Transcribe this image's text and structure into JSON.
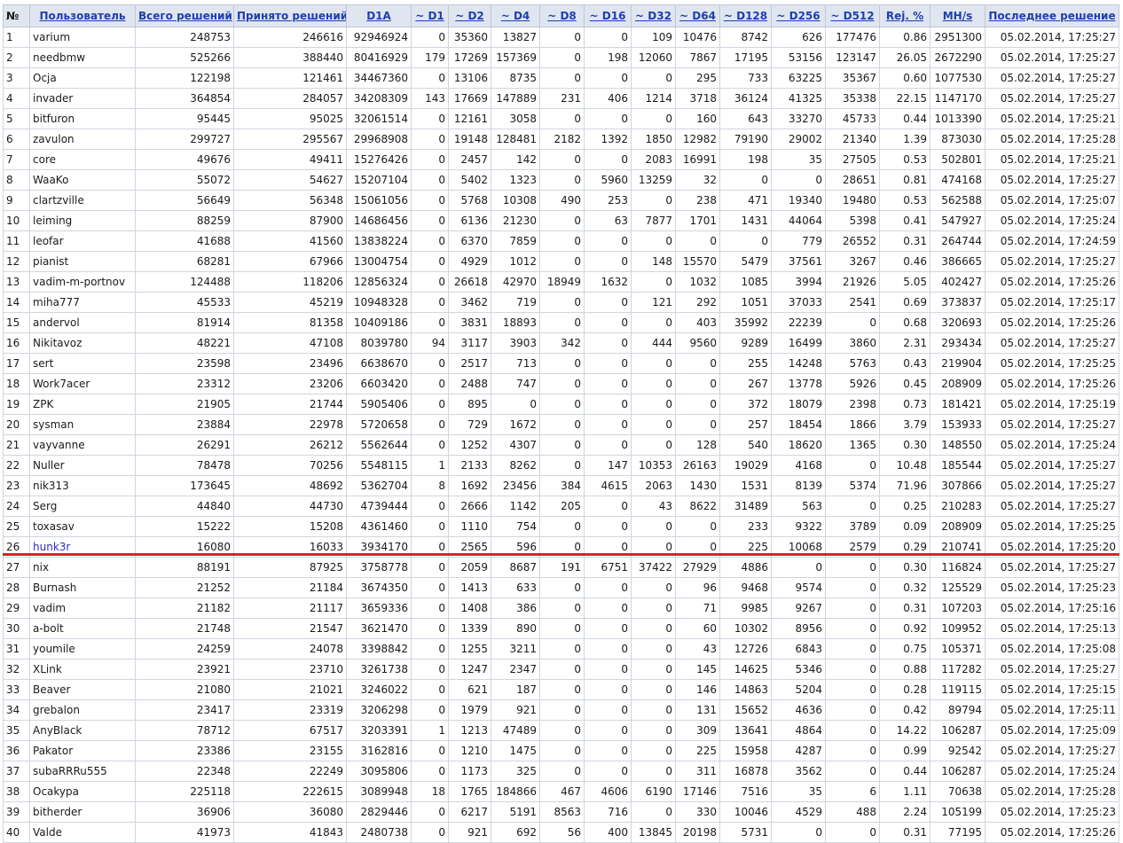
{
  "table": {
    "headers": [
      {
        "label": "№",
        "key": "num",
        "link": false
      },
      {
        "label": "Пользователь",
        "key": "user",
        "link": true
      },
      {
        "label": "Всего решений",
        "key": "total",
        "link": true
      },
      {
        "label": "Принято решений",
        "key": "accepted",
        "link": true
      },
      {
        "label": "D1A",
        "key": "d1a",
        "link": true
      },
      {
        "label": "~ D1",
        "key": "d1",
        "link": true
      },
      {
        "label": "~ D2",
        "key": "d2",
        "link": true
      },
      {
        "label": "~ D4",
        "key": "d4",
        "link": true
      },
      {
        "label": "~ D8",
        "key": "d8",
        "link": true
      },
      {
        "label": "~ D16",
        "key": "d16",
        "link": true
      },
      {
        "label": "~ D32",
        "key": "d32",
        "link": true
      },
      {
        "label": "~ D64",
        "key": "d64",
        "link": true
      },
      {
        "label": "~ D128",
        "key": "d128",
        "link": true
      },
      {
        "label": "~ D256",
        "key": "d256",
        "link": true
      },
      {
        "label": "~ D512",
        "key": "d512",
        "link": true
      },
      {
        "label": "Rej. %",
        "key": "rej",
        "link": true
      },
      {
        "label": "MH/s",
        "key": "mhs",
        "link": true
      },
      {
        "label": "Последнее решение",
        "key": "last",
        "link": true
      }
    ],
    "highlighted_row": 26,
    "highlight_color": "#e0202a",
    "rows": [
      [
        "1",
        "varium",
        "248753",
        "246616",
        "92946924",
        "0",
        "35360",
        "13827",
        "0",
        "0",
        "109",
        "10476",
        "8742",
        "626",
        "177476",
        "0.86",
        "2951300",
        "05.02.2014, 17:25:27"
      ],
      [
        "2",
        "needbmw",
        "525266",
        "388440",
        "80416929",
        "179",
        "17269",
        "157369",
        "0",
        "198",
        "12060",
        "7867",
        "17195",
        "53156",
        "123147",
        "26.05",
        "2672290",
        "05.02.2014, 17:25:27"
      ],
      [
        "3",
        "Ocja",
        "122198",
        "121461",
        "34467360",
        "0",
        "13106",
        "8735",
        "0",
        "0",
        "0",
        "295",
        "733",
        "63225",
        "35367",
        "0.60",
        "1077530",
        "05.02.2014, 17:25:27"
      ],
      [
        "4",
        "invader",
        "364854",
        "284057",
        "34208309",
        "143",
        "17669",
        "147889",
        "231",
        "406",
        "1214",
        "3718",
        "36124",
        "41325",
        "35338",
        "22.15",
        "1147170",
        "05.02.2014, 17:25:27"
      ],
      [
        "5",
        "bitfuron",
        "95445",
        "95025",
        "32061514",
        "0",
        "12161",
        "3058",
        "0",
        "0",
        "0",
        "160",
        "643",
        "33270",
        "45733",
        "0.44",
        "1013390",
        "05.02.2014, 17:25:21"
      ],
      [
        "6",
        "zavulon",
        "299727",
        "295567",
        "29968908",
        "0",
        "19148",
        "128481",
        "2182",
        "1392",
        "1850",
        "12982",
        "79190",
        "29002",
        "21340",
        "1.39",
        "873030",
        "05.02.2014, 17:25:28"
      ],
      [
        "7",
        "core",
        "49676",
        "49411",
        "15276426",
        "0",
        "2457",
        "142",
        "0",
        "0",
        "2083",
        "16991",
        "198",
        "35",
        "27505",
        "0.53",
        "502801",
        "05.02.2014, 17:25:21"
      ],
      [
        "8",
        "WaaKo",
        "55072",
        "54627",
        "15207104",
        "0",
        "5402",
        "1323",
        "0",
        "5960",
        "13259",
        "32",
        "0",
        "0",
        "28651",
        "0.81",
        "474168",
        "05.02.2014, 17:25:27"
      ],
      [
        "9",
        "clartzville",
        "56649",
        "56348",
        "15061056",
        "0",
        "5768",
        "10308",
        "490",
        "253",
        "0",
        "238",
        "471",
        "19340",
        "19480",
        "0.53",
        "562588",
        "05.02.2014, 17:25:07"
      ],
      [
        "10",
        "leiming",
        "88259",
        "87900",
        "14686456",
        "0",
        "6136",
        "21230",
        "0",
        "63",
        "7877",
        "1701",
        "1431",
        "44064",
        "5398",
        "0.41",
        "547927",
        "05.02.2014, 17:25:24"
      ],
      [
        "11",
        "leofar",
        "41688",
        "41560",
        "13838224",
        "0",
        "6370",
        "7859",
        "0",
        "0",
        "0",
        "0",
        "0",
        "779",
        "26552",
        "0.31",
        "264744",
        "05.02.2014, 17:24:59"
      ],
      [
        "12",
        "pianist",
        "68281",
        "67966",
        "13004754",
        "0",
        "4929",
        "1012",
        "0",
        "0",
        "148",
        "15570",
        "5479",
        "37561",
        "3267",
        "0.46",
        "386665",
        "05.02.2014, 17:25:27"
      ],
      [
        "13",
        "vadim-m-portnov",
        "124488",
        "118206",
        "12856324",
        "0",
        "26618",
        "42970",
        "18949",
        "1632",
        "0",
        "1032",
        "1085",
        "3994",
        "21926",
        "5.05",
        "402427",
        "05.02.2014, 17:25:26"
      ],
      [
        "14",
        "miha777",
        "45533",
        "45219",
        "10948328",
        "0",
        "3462",
        "719",
        "0",
        "0",
        "121",
        "292",
        "1051",
        "37033",
        "2541",
        "0.69",
        "373837",
        "05.02.2014, 17:25:17"
      ],
      [
        "15",
        "andervol",
        "81914",
        "81358",
        "10409186",
        "0",
        "3831",
        "18893",
        "0",
        "0",
        "0",
        "403",
        "35992",
        "22239",
        "0",
        "0.68",
        "320693",
        "05.02.2014, 17:25:26"
      ],
      [
        "16",
        "Nikitavoz",
        "48221",
        "47108",
        "8039780",
        "94",
        "3117",
        "3903",
        "342",
        "0",
        "444",
        "9560",
        "9289",
        "16499",
        "3860",
        "2.31",
        "293434",
        "05.02.2014, 17:25:27"
      ],
      [
        "17",
        "sert",
        "23598",
        "23496",
        "6638670",
        "0",
        "2517",
        "713",
        "0",
        "0",
        "0",
        "0",
        "255",
        "14248",
        "5763",
        "0.43",
        "219904",
        "05.02.2014, 17:25:25"
      ],
      [
        "18",
        "Work7acer",
        "23312",
        "23206",
        "6603420",
        "0",
        "2488",
        "747",
        "0",
        "0",
        "0",
        "0",
        "267",
        "13778",
        "5926",
        "0.45",
        "208909",
        "05.02.2014, 17:25:26"
      ],
      [
        "19",
        "ZPK",
        "21905",
        "21744",
        "5905406",
        "0",
        "895",
        "0",
        "0",
        "0",
        "0",
        "0",
        "372",
        "18079",
        "2398",
        "0.73",
        "181421",
        "05.02.2014, 17:25:19"
      ],
      [
        "20",
        "sysman",
        "23884",
        "22978",
        "5720658",
        "0",
        "729",
        "1672",
        "0",
        "0",
        "0",
        "0",
        "257",
        "18454",
        "1866",
        "3.79",
        "153933",
        "05.02.2014, 17:25:27"
      ],
      [
        "21",
        "vayvanne",
        "26291",
        "26212",
        "5562644",
        "0",
        "1252",
        "4307",
        "0",
        "0",
        "0",
        "128",
        "540",
        "18620",
        "1365",
        "0.30",
        "148550",
        "05.02.2014, 17:25:24"
      ],
      [
        "22",
        "Nuller",
        "78478",
        "70256",
        "5548115",
        "1",
        "2133",
        "8262",
        "0",
        "147",
        "10353",
        "26163",
        "19029",
        "4168",
        "0",
        "10.48",
        "185544",
        "05.02.2014, 17:25:27"
      ],
      [
        "23",
        "nik313",
        "173645",
        "48692",
        "5362704",
        "8",
        "1692",
        "23456",
        "384",
        "4615",
        "2063",
        "1430",
        "1531",
        "8139",
        "5374",
        "71.96",
        "307866",
        "05.02.2014, 17:25:27"
      ],
      [
        "24",
        "Serg",
        "44840",
        "44730",
        "4739444",
        "0",
        "2666",
        "1142",
        "205",
        "0",
        "43",
        "8622",
        "31489",
        "563",
        "0",
        "0.25",
        "210283",
        "05.02.2014, 17:25:27"
      ],
      [
        "25",
        "toxasav",
        "15222",
        "15208",
        "4361460",
        "0",
        "1110",
        "754",
        "0",
        "0",
        "0",
        "0",
        "233",
        "9322",
        "3789",
        "0.09",
        "208909",
        "05.02.2014, 17:25:25"
      ],
      [
        "26",
        "hunk3r",
        "16080",
        "16033",
        "3934170",
        "0",
        "2565",
        "596",
        "0",
        "0",
        "0",
        "0",
        "225",
        "10068",
        "2579",
        "0.29",
        "210741",
        "05.02.2014, 17:25:20"
      ],
      [
        "27",
        "nix",
        "88191",
        "87925",
        "3758778",
        "0",
        "2059",
        "8687",
        "191",
        "6751",
        "37422",
        "27929",
        "4886",
        "0",
        "0",
        "0.30",
        "116824",
        "05.02.2014, 17:25:27"
      ],
      [
        "28",
        "Burnash",
        "21252",
        "21184",
        "3674350",
        "0",
        "1413",
        "633",
        "0",
        "0",
        "0",
        "96",
        "9468",
        "9574",
        "0",
        "0.32",
        "125529",
        "05.02.2014, 17:25:23"
      ],
      [
        "29",
        "vadim",
        "21182",
        "21117",
        "3659336",
        "0",
        "1408",
        "386",
        "0",
        "0",
        "0",
        "71",
        "9985",
        "9267",
        "0",
        "0.31",
        "107203",
        "05.02.2014, 17:25:16"
      ],
      [
        "30",
        "a-bolt",
        "21748",
        "21547",
        "3621470",
        "0",
        "1339",
        "890",
        "0",
        "0",
        "0",
        "60",
        "10302",
        "8956",
        "0",
        "0.92",
        "109952",
        "05.02.2014, 17:25:13"
      ],
      [
        "31",
        "youmile",
        "24259",
        "24078",
        "3398842",
        "0",
        "1255",
        "3211",
        "0",
        "0",
        "0",
        "43",
        "12726",
        "6843",
        "0",
        "0.75",
        "105371",
        "05.02.2014, 17:25:08"
      ],
      [
        "32",
        "XLink",
        "23921",
        "23710",
        "3261738",
        "0",
        "1247",
        "2347",
        "0",
        "0",
        "0",
        "145",
        "14625",
        "5346",
        "0",
        "0.88",
        "117282",
        "05.02.2014, 17:25:27"
      ],
      [
        "33",
        "Beaver",
        "21080",
        "21021",
        "3246022",
        "0",
        "621",
        "187",
        "0",
        "0",
        "0",
        "146",
        "14863",
        "5204",
        "0",
        "0.28",
        "119115",
        "05.02.2014, 17:25:15"
      ],
      [
        "34",
        "grebalon",
        "23417",
        "23319",
        "3206298",
        "0",
        "1979",
        "921",
        "0",
        "0",
        "0",
        "131",
        "15652",
        "4636",
        "0",
        "0.42",
        "89794",
        "05.02.2014, 17:25:11"
      ],
      [
        "35",
        "AnyBlack",
        "78712",
        "67517",
        "3203391",
        "1",
        "1213",
        "47489",
        "0",
        "0",
        "0",
        "309",
        "13641",
        "4864",
        "0",
        "14.22",
        "106287",
        "05.02.2014, 17:25:09"
      ],
      [
        "36",
        "Pakator",
        "23386",
        "23155",
        "3162816",
        "0",
        "1210",
        "1475",
        "0",
        "0",
        "0",
        "225",
        "15958",
        "4287",
        "0",
        "0.99",
        "92542",
        "05.02.2014, 17:25:27"
      ],
      [
        "37",
        "subaRRRu555",
        "22348",
        "22249",
        "3095806",
        "0",
        "1173",
        "325",
        "0",
        "0",
        "0",
        "311",
        "16878",
        "3562",
        "0",
        "0.44",
        "106287",
        "05.02.2014, 17:25:24"
      ],
      [
        "38",
        "Ocakypa",
        "225118",
        "222615",
        "3089948",
        "18",
        "1765",
        "184866",
        "467",
        "4606",
        "6190",
        "17146",
        "7516",
        "35",
        "6",
        "1.11",
        "70638",
        "05.02.2014, 17:25:28"
      ],
      [
        "39",
        "bitherder",
        "36906",
        "36080",
        "2829446",
        "0",
        "6217",
        "5191",
        "8563",
        "716",
        "0",
        "330",
        "10046",
        "4529",
        "488",
        "2.24",
        "105199",
        "05.02.2014, 17:25:23"
      ],
      [
        "40",
        "Valde",
        "41973",
        "41843",
        "2480738",
        "0",
        "921",
        "692",
        "56",
        "400",
        "13845",
        "20198",
        "5731",
        "0",
        "0",
        "0.31",
        "77195",
        "05.02.2014, 17:25:26"
      ]
    ]
  }
}
